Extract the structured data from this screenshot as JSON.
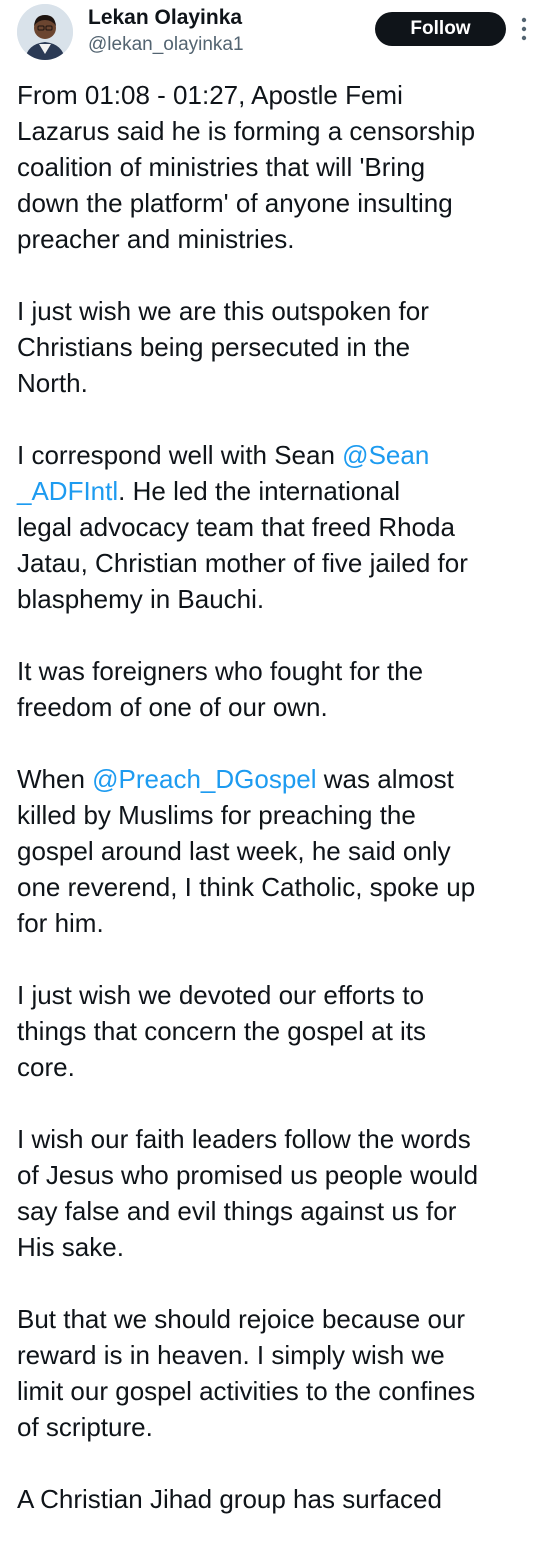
{
  "author": {
    "display_name": "Lekan Olayinka",
    "handle": "@lekan_olayinka1"
  },
  "actions": {
    "follow_label": "Follow",
    "more_icon": "more-vertical-icon"
  },
  "colors": {
    "text": "#0f1419",
    "secondary": "#536471",
    "link": "#1d9bf0",
    "button_bg": "#0f1419"
  },
  "tweet": {
    "p1": {
      "lines": [
        "From 01:08 - 01:27, Apostle Femi",
        "Lazarus said he is forming a censorship",
        "coalition of ministries that will 'Bring",
        "down the platform' of anyone insulting",
        "preacher and ministries."
      ]
    },
    "p2": {
      "lines": [
        "I just wish we are this outspoken for",
        "Christians being persecuted in the",
        "North."
      ]
    },
    "p3": {
      "l1_pre": "I correspond well with Sean ",
      "l1_mention": "@Sean",
      "l2_mention": "_ADFIntl",
      "l2_post": ". He led the international",
      "lines_rest": [
        "legal advocacy team that freed Rhoda",
        "Jatau, Christian mother of five jailed for",
        "blasphemy in Bauchi."
      ]
    },
    "p4": {
      "lines": [
        "It was foreigners who fought for the",
        "freedom of one of our own."
      ]
    },
    "p5": {
      "l1_pre": "When ",
      "l1_mention": "@Preach_DGospel",
      "l1_post": " was almost",
      "lines_rest": [
        "killed by Muslims for preaching the",
        "gospel around last week, he said only",
        "one reverend, I think Catholic, spoke up",
        "for him."
      ]
    },
    "p6": {
      "lines": [
        "I just wish we devoted our efforts to",
        "things that concern the gospel at its",
        "core."
      ]
    },
    "p7": {
      "lines": [
        "I wish our faith leaders follow the words",
        "of Jesus who promised us people would",
        "say false and evil things against us for",
        "His sake."
      ]
    },
    "p8": {
      "lines": [
        "But that we should rejoice because our",
        "reward is in heaven. I simply wish we",
        "limit our gospel activities to the confines",
        "of scripture."
      ]
    },
    "p9": {
      "lines": [
        "A Christian Jihad group has surfaced"
      ]
    }
  }
}
